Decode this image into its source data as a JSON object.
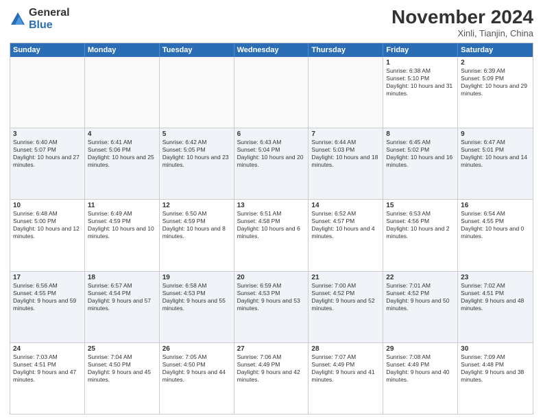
{
  "logo": {
    "general": "General",
    "blue": "Blue"
  },
  "header": {
    "month": "November 2024",
    "location": "Xinli, Tianjin, China"
  },
  "weekdays": [
    "Sunday",
    "Monday",
    "Tuesday",
    "Wednesday",
    "Thursday",
    "Friday",
    "Saturday"
  ],
  "rows": [
    [
      {
        "day": "",
        "info": ""
      },
      {
        "day": "",
        "info": ""
      },
      {
        "day": "",
        "info": ""
      },
      {
        "day": "",
        "info": ""
      },
      {
        "day": "",
        "info": ""
      },
      {
        "day": "1",
        "info": "Sunrise: 6:38 AM\nSunset: 5:10 PM\nDaylight: 10 hours and 31 minutes."
      },
      {
        "day": "2",
        "info": "Sunrise: 6:39 AM\nSunset: 5:09 PM\nDaylight: 10 hours and 29 minutes."
      }
    ],
    [
      {
        "day": "3",
        "info": "Sunrise: 6:40 AM\nSunset: 5:07 PM\nDaylight: 10 hours and 27 minutes."
      },
      {
        "day": "4",
        "info": "Sunrise: 6:41 AM\nSunset: 5:06 PM\nDaylight: 10 hours and 25 minutes."
      },
      {
        "day": "5",
        "info": "Sunrise: 6:42 AM\nSunset: 5:05 PM\nDaylight: 10 hours and 23 minutes."
      },
      {
        "day": "6",
        "info": "Sunrise: 6:43 AM\nSunset: 5:04 PM\nDaylight: 10 hours and 20 minutes."
      },
      {
        "day": "7",
        "info": "Sunrise: 6:44 AM\nSunset: 5:03 PM\nDaylight: 10 hours and 18 minutes."
      },
      {
        "day": "8",
        "info": "Sunrise: 6:45 AM\nSunset: 5:02 PM\nDaylight: 10 hours and 16 minutes."
      },
      {
        "day": "9",
        "info": "Sunrise: 6:47 AM\nSunset: 5:01 PM\nDaylight: 10 hours and 14 minutes."
      }
    ],
    [
      {
        "day": "10",
        "info": "Sunrise: 6:48 AM\nSunset: 5:00 PM\nDaylight: 10 hours and 12 minutes."
      },
      {
        "day": "11",
        "info": "Sunrise: 6:49 AM\nSunset: 4:59 PM\nDaylight: 10 hours and 10 minutes."
      },
      {
        "day": "12",
        "info": "Sunrise: 6:50 AM\nSunset: 4:59 PM\nDaylight: 10 hours and 8 minutes."
      },
      {
        "day": "13",
        "info": "Sunrise: 6:51 AM\nSunset: 4:58 PM\nDaylight: 10 hours and 6 minutes."
      },
      {
        "day": "14",
        "info": "Sunrise: 6:52 AM\nSunset: 4:57 PM\nDaylight: 10 hours and 4 minutes."
      },
      {
        "day": "15",
        "info": "Sunrise: 6:53 AM\nSunset: 4:56 PM\nDaylight: 10 hours and 2 minutes."
      },
      {
        "day": "16",
        "info": "Sunrise: 6:54 AM\nSunset: 4:55 PM\nDaylight: 10 hours and 0 minutes."
      }
    ],
    [
      {
        "day": "17",
        "info": "Sunrise: 6:56 AM\nSunset: 4:55 PM\nDaylight: 9 hours and 59 minutes."
      },
      {
        "day": "18",
        "info": "Sunrise: 6:57 AM\nSunset: 4:54 PM\nDaylight: 9 hours and 57 minutes."
      },
      {
        "day": "19",
        "info": "Sunrise: 6:58 AM\nSunset: 4:53 PM\nDaylight: 9 hours and 55 minutes."
      },
      {
        "day": "20",
        "info": "Sunrise: 6:59 AM\nSunset: 4:53 PM\nDaylight: 9 hours and 53 minutes."
      },
      {
        "day": "21",
        "info": "Sunrise: 7:00 AM\nSunset: 4:52 PM\nDaylight: 9 hours and 52 minutes."
      },
      {
        "day": "22",
        "info": "Sunrise: 7:01 AM\nSunset: 4:52 PM\nDaylight: 9 hours and 50 minutes."
      },
      {
        "day": "23",
        "info": "Sunrise: 7:02 AM\nSunset: 4:51 PM\nDaylight: 9 hours and 48 minutes."
      }
    ],
    [
      {
        "day": "24",
        "info": "Sunrise: 7:03 AM\nSunset: 4:51 PM\nDaylight: 9 hours and 47 minutes."
      },
      {
        "day": "25",
        "info": "Sunrise: 7:04 AM\nSunset: 4:50 PM\nDaylight: 9 hours and 45 minutes."
      },
      {
        "day": "26",
        "info": "Sunrise: 7:05 AM\nSunset: 4:50 PM\nDaylight: 9 hours and 44 minutes."
      },
      {
        "day": "27",
        "info": "Sunrise: 7:06 AM\nSunset: 4:49 PM\nDaylight: 9 hours and 42 minutes."
      },
      {
        "day": "28",
        "info": "Sunrise: 7:07 AM\nSunset: 4:49 PM\nDaylight: 9 hours and 41 minutes."
      },
      {
        "day": "29",
        "info": "Sunrise: 7:08 AM\nSunset: 4:49 PM\nDaylight: 9 hours and 40 minutes."
      },
      {
        "day": "30",
        "info": "Sunrise: 7:09 AM\nSunset: 4:48 PM\nDaylight: 9 hours and 38 minutes."
      }
    ]
  ]
}
